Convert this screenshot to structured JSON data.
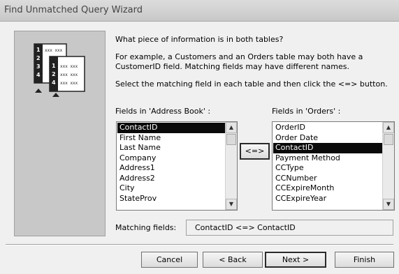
{
  "window": {
    "title": "Find Unmatched Query Wizard"
  },
  "instructions": {
    "question": "What piece of information is in both tables?",
    "example_line1": "For example, a Customers and an Orders table may both have a",
    "example_line2": "CustomerID field. Matching fields may have different names.",
    "select_line": "Select the matching field in each table and then click the <=> button."
  },
  "illustration": {
    "table1_rows": [
      "1",
      "2",
      "3",
      "4"
    ],
    "table2_rows": [
      "1",
      "2",
      "4"
    ],
    "placeholder": "xxx xxx"
  },
  "left_list": {
    "label": "Fields in 'Address Book' :",
    "items": [
      "ContactID",
      "First Name",
      "Last Name",
      "Company",
      "Address1",
      "Address2",
      "City",
      "StateProv"
    ],
    "selected": "ContactID"
  },
  "right_list": {
    "label": "Fields in 'Orders' :",
    "items": [
      "OrderID",
      "Order Date",
      "ContactID",
      "Payment Method",
      "CCType",
      "CCNumber",
      "CCExpireMonth",
      "CCExpireYear"
    ],
    "selected": "ContactID"
  },
  "match_button": {
    "label": "<=>"
  },
  "matching": {
    "label": "Matching fields:",
    "value": "ContactID <=> ContactID"
  },
  "buttons": {
    "cancel": "Cancel",
    "back": "< Back",
    "next": "Next >",
    "finish": "Finish"
  }
}
